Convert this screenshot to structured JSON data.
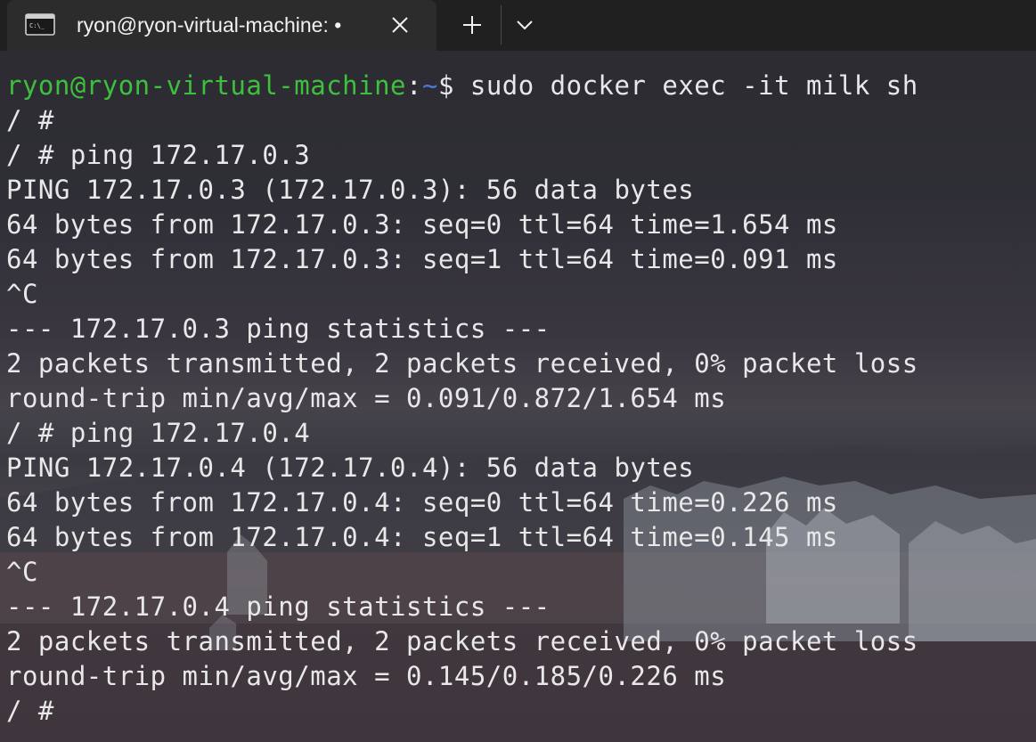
{
  "tab": {
    "title": "ryon@ryon-virtual-machine: •",
    "icon": "terminal-icon"
  },
  "colors": {
    "prompt_user": "#3ec03e",
    "prompt_path": "#4a7bd8",
    "text": "#e8e8e8",
    "tabbar": "#202020",
    "tab_active": "#2c2c2c"
  },
  "terminal": {
    "prompt": {
      "user_host": "ryon@ryon-virtual-machine",
      "colon": ":",
      "path": "~",
      "symbol": "$ ",
      "command": "sudo docker exec -it milk sh"
    },
    "lines": [
      "/ #",
      "/ # ping 172.17.0.3",
      "PING 172.17.0.3 (172.17.0.3): 56 data bytes",
      "64 bytes from 172.17.0.3: seq=0 ttl=64 time=1.654 ms",
      "64 bytes from 172.17.0.3: seq=1 ttl=64 time=0.091 ms",
      "^C",
      "--- 172.17.0.3 ping statistics ---",
      "2 packets transmitted, 2 packets received, 0% packet loss",
      "round-trip min/avg/max = 0.091/0.872/1.654 ms",
      "/ # ping 172.17.0.4",
      "PING 172.17.0.4 (172.17.0.4): 56 data bytes",
      "64 bytes from 172.17.0.4: seq=0 ttl=64 time=0.226 ms",
      "64 bytes from 172.17.0.4: seq=1 ttl=64 time=0.145 ms",
      "^C",
      "--- 172.17.0.4 ping statistics ---",
      "2 packets transmitted, 2 packets received, 0% packet loss",
      "round-trip min/avg/max = 0.145/0.185/0.226 ms",
      "/ #"
    ]
  }
}
